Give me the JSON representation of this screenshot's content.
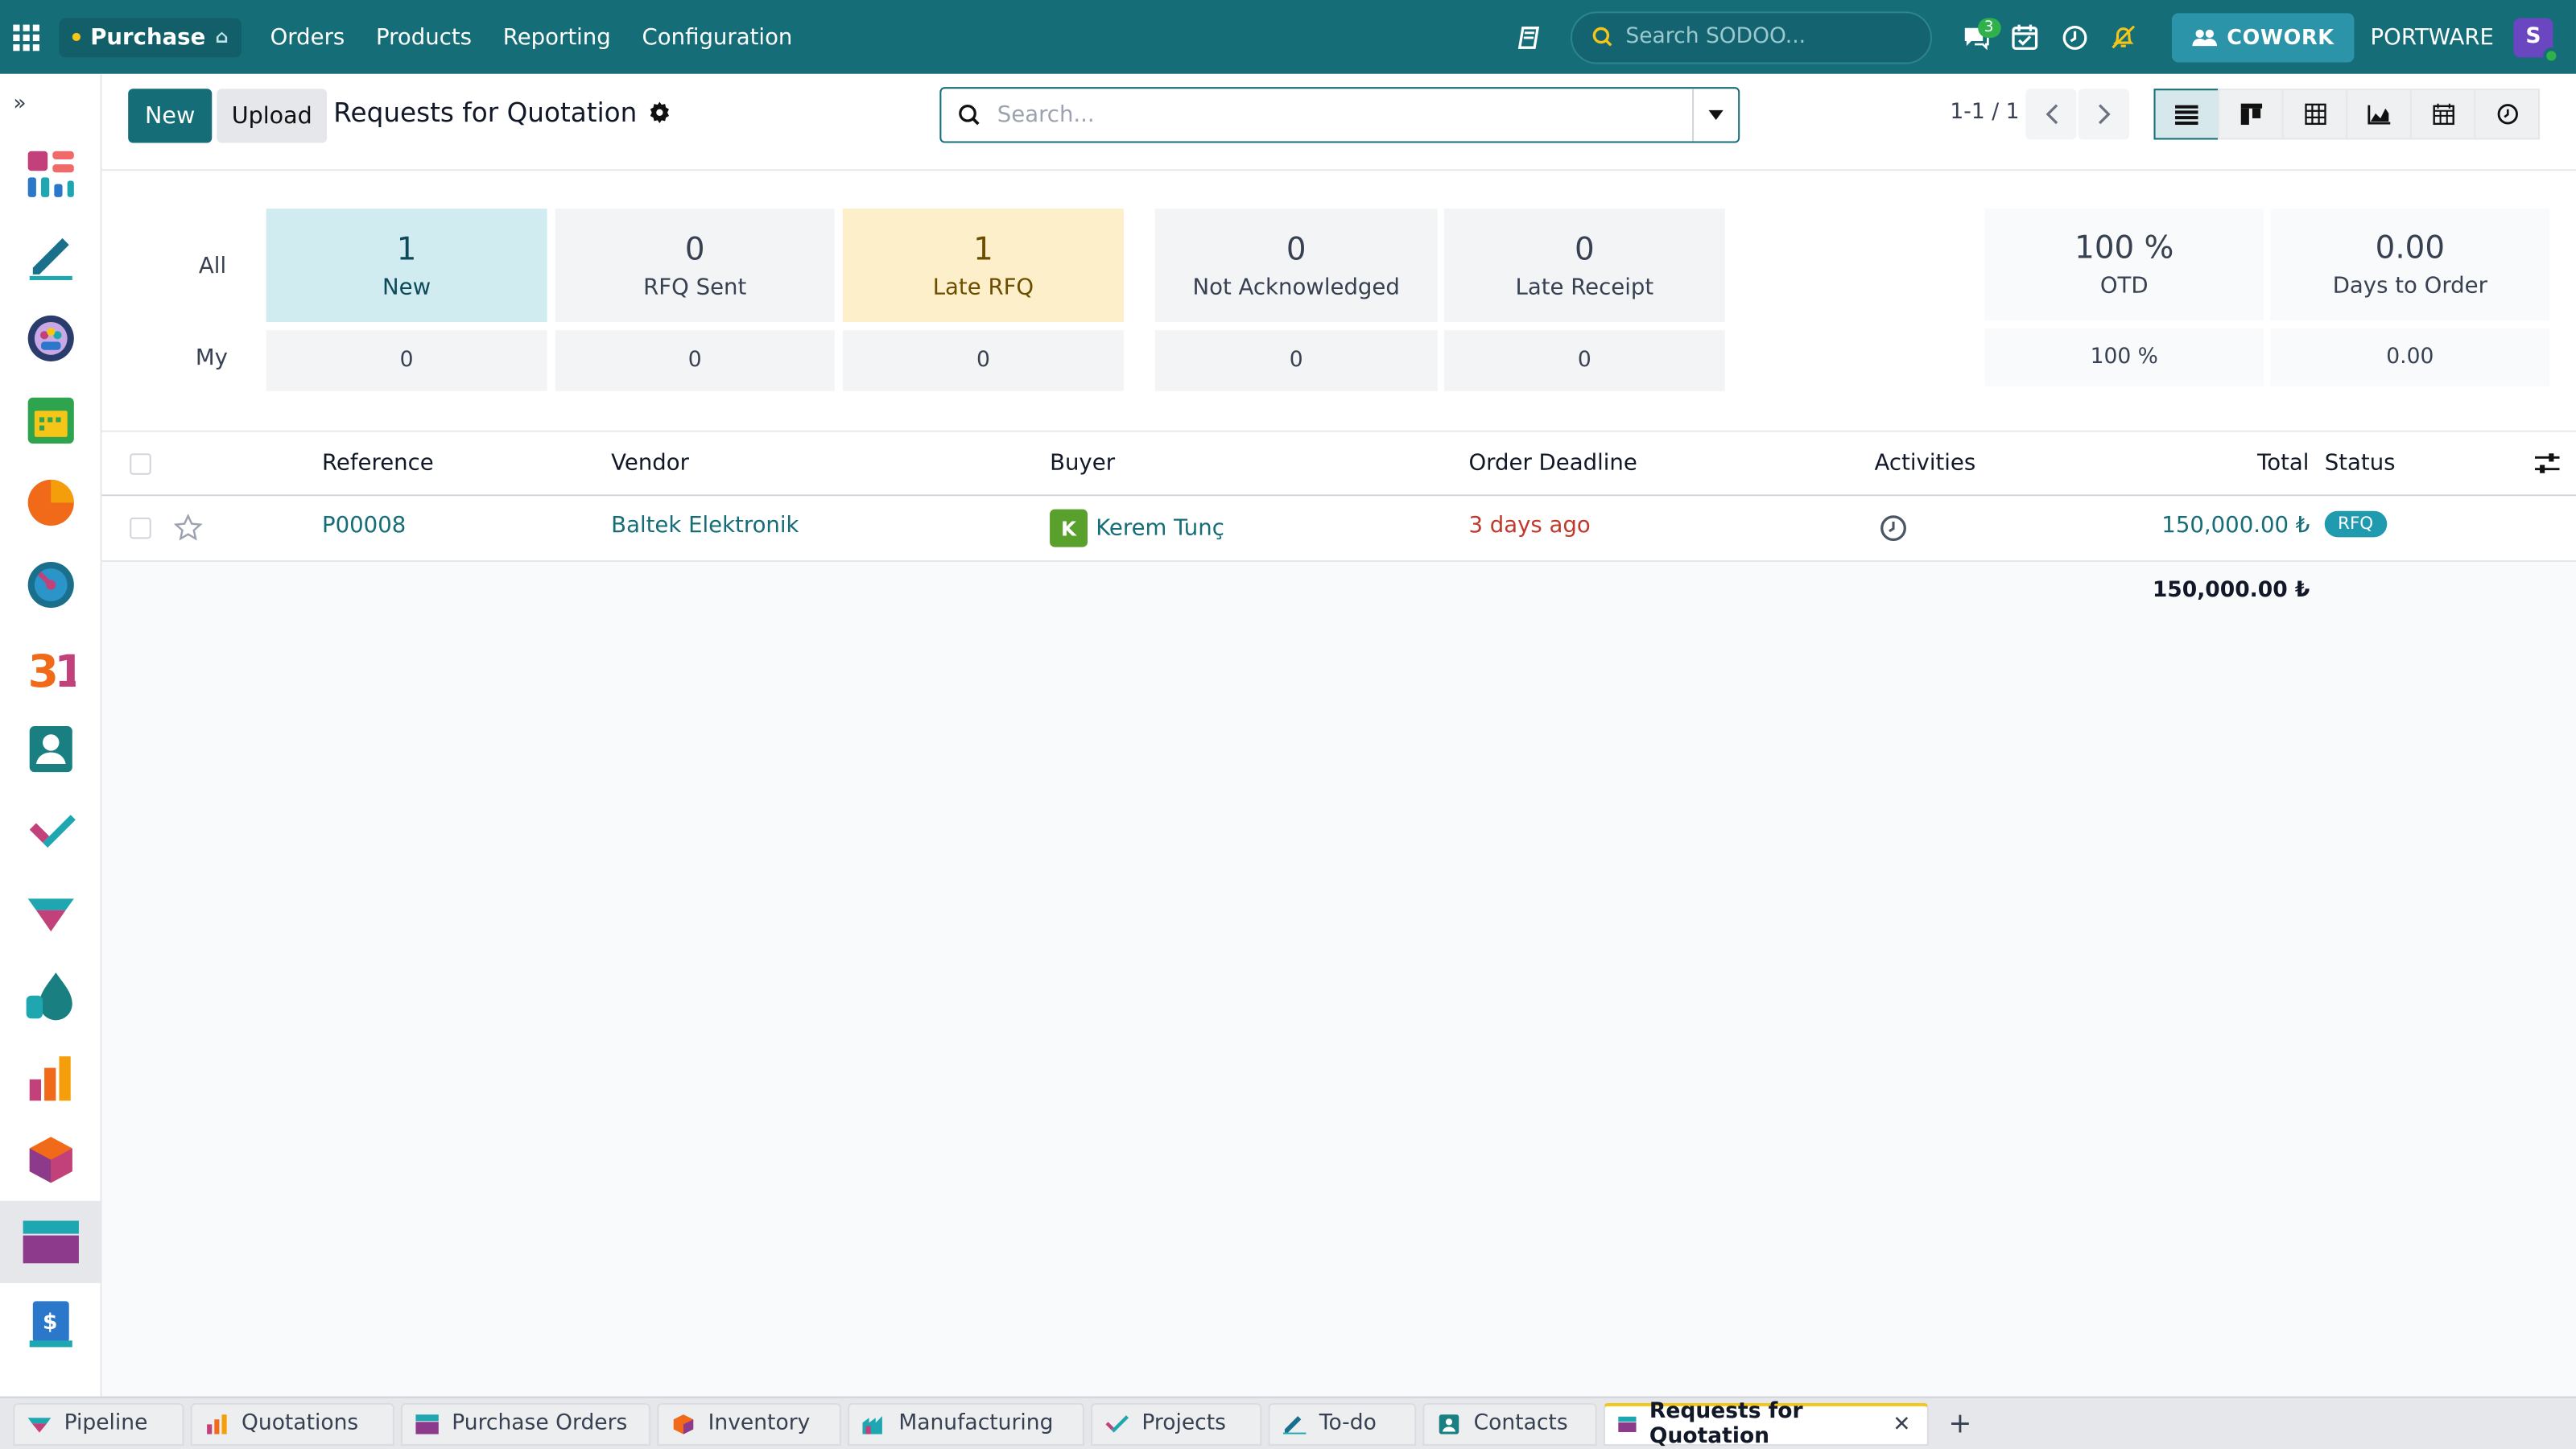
{
  "topbar": {
    "app_name": "Purchase",
    "menu": [
      "Orders",
      "Products",
      "Reporting",
      "Configuration"
    ],
    "search_placeholder": "Search SODOO...",
    "chat_badge": "3",
    "cowork_label": "COWORK",
    "company": "PORTWARE",
    "avatar_letter": "S"
  },
  "control_panel": {
    "new_label": "New",
    "upload_label": "Upload",
    "title": "Requests for Quotation",
    "search_placeholder": "Search...",
    "pager": "1-1 / 1"
  },
  "dashboard": {
    "row_labels": {
      "all": "All",
      "my": "My"
    },
    "tiles": [
      {
        "value": "1",
        "label": "New"
      },
      {
        "value": "0",
        "label": "RFQ Sent"
      },
      {
        "value": "1",
        "label": "Late RFQ"
      },
      {
        "value": "0",
        "label": "Not Acknowledged"
      },
      {
        "value": "0",
        "label": "Late Receipt"
      },
      {
        "value": "100 %",
        "label": "OTD"
      },
      {
        "value": "0.00",
        "label": "Days to Order"
      }
    ],
    "my_values": [
      "0",
      "0",
      "0",
      "0",
      "0",
      "100 %",
      "0.00"
    ]
  },
  "list": {
    "columns": {
      "reference": "Reference",
      "vendor": "Vendor",
      "buyer": "Buyer",
      "deadline": "Order Deadline",
      "activities": "Activities",
      "total": "Total",
      "status": "Status"
    },
    "rows": [
      {
        "reference": "P00008",
        "vendor": "Baltek Elektronik",
        "buyer_initial": "K",
        "buyer": "Kerem Tunç",
        "deadline": "3 days ago",
        "total": "150,000.00 ₺",
        "status": "RFQ"
      }
    ],
    "sum_total": "150,000.00 ₺"
  },
  "tabs": [
    {
      "label": "Pipeline",
      "active": false
    },
    {
      "label": "Quotations",
      "active": false
    },
    {
      "label": "Purchase Orders",
      "active": false
    },
    {
      "label": "Inventory",
      "active": false
    },
    {
      "label": "Manufacturing",
      "active": false
    },
    {
      "label": "Projects",
      "active": false
    },
    {
      "label": "To-do",
      "active": false
    },
    {
      "label": "Contacts",
      "active": false
    },
    {
      "label": "Requests for Quotation",
      "active": true
    }
  ],
  "colors": {
    "primary": "#156d78",
    "new_tile": "#d1ecf1",
    "late_tile": "#fdefc9",
    "late_text": "#c0392b",
    "status_badge": "#1f9aae"
  }
}
